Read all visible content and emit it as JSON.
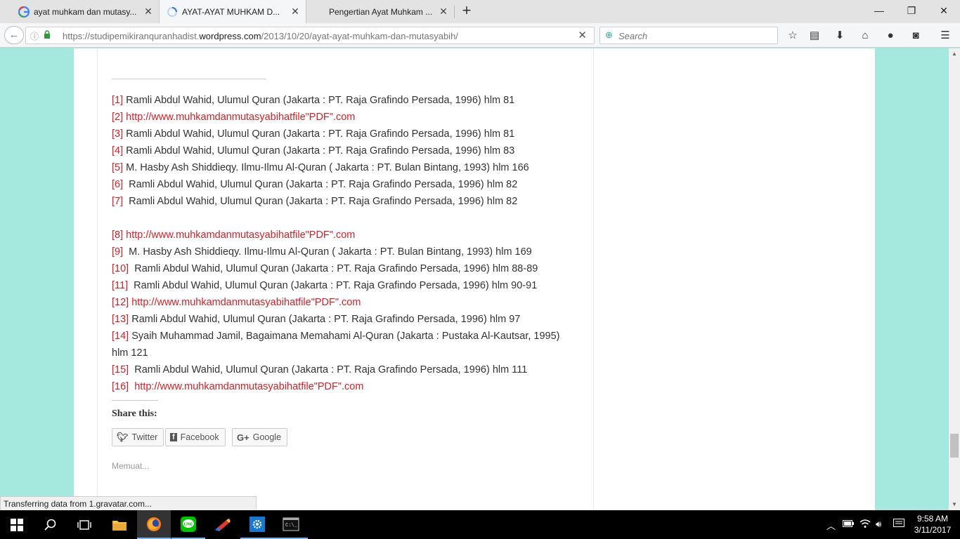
{
  "browser": {
    "tabs": [
      {
        "title": "ayat muhkam dan mutasy...",
        "icon": "google-icon",
        "active": false
      },
      {
        "title": "AYAT-AYAT MUHKAM D...",
        "icon": "loading-icon",
        "active": true
      },
      {
        "title": "Pengertian Ayat Muhkam ...",
        "icon": "blank-page-icon",
        "active": false
      }
    ],
    "url_prefix": "https://studipemikiranquranhadist.",
    "url_domain": "wordpress.com",
    "url_path": "/2013/10/20/ayat-ayat-muhkam-dan-mutasyabih/",
    "search_placeholder": "Search"
  },
  "footnotes": [
    {
      "ref": "[1]",
      "text": " Ramli Abdul Wahid, Ulumul Quran (Jakarta : PT. Raja Grafindo Persada, 1996) hlm 81",
      "is_link": false
    },
    {
      "ref": "[2]",
      "text": " http://www.muhkamdanmutasyabihatfile\"PDF\".com",
      "is_link": true
    },
    {
      "ref": "[3]",
      "text": " Ramli Abdul Wahid, Ulumul Quran (Jakarta : PT. Raja Grafindo Persada, 1996) hlm 81",
      "is_link": false
    },
    {
      "ref": "[4]",
      "text": " Ramli Abdul Wahid, Ulumul Quran (Jakarta : PT. Raja Grafindo Persada, 1996) hlm 83",
      "is_link": false
    },
    {
      "ref": "[5]",
      "text": " M. Hasby Ash Shiddieqy. Ilmu-Ilmu Al-Quran ( Jakarta : PT. Bulan Bintang, 1993) hlm 166",
      "is_link": false
    },
    {
      "ref": "[6]",
      "text": "  Ramli Abdul Wahid, Ulumul Quran (Jakarta : PT. Raja Grafindo Persada, 1996) hlm 82",
      "is_link": false
    },
    {
      "ref": "[7]",
      "text": "  Ramli Abdul Wahid, Ulumul Quran (Jakarta : PT. Raja Grafindo Persada, 1996) hlm 82",
      "is_link": false
    },
    {
      "ref": "[8]",
      "text": " http://www.muhkamdanmutasyabihatfile\"PDF\".com",
      "is_link": true
    },
    {
      "ref": "[9]",
      "text": "  M. Hasby Ash Shiddieqy. Ilmu-Ilmu Al-Quran ( Jakarta : PT. Bulan Bintang, 1993) hlm 169",
      "is_link": false
    },
    {
      "ref": "[10]",
      "text": "  Ramli Abdul Wahid, Ulumul Quran (Jakarta : PT. Raja Grafindo Persada, 1996) hlm 88-89",
      "is_link": false
    },
    {
      "ref": "[11]",
      "text": "  Ramli Abdul Wahid, Ulumul Quran (Jakarta : PT. Raja Grafindo Persada, 1996) hlm 90-91",
      "is_link": false
    },
    {
      "ref": "[12]",
      "text": " http://www.muhkamdanmutasyabihatfile\"PDF\".com",
      "is_link": true
    },
    {
      "ref": "[13]",
      "text": " Ramli Abdul Wahid, Ulumul Quran (Jakarta : PT. Raja Grafindo Persada, 1996) hlm 97",
      "is_link": false
    },
    {
      "ref": "[14]",
      "text": " Syaih Muhammad Jamil, Bagaimana Memahami Al-Quran (Jakarta : Pustaka Al-Kautsar, 1995) hlm 121",
      "is_link": false
    },
    {
      "ref": "[15]",
      "text": "  Ramli Abdul Wahid, Ulumul Quran (Jakarta : PT. Raja Grafindo Persada, 1996) hlm 111",
      "is_link": false
    },
    {
      "ref": "[16]",
      "text": "  http://www.muhkamdanmutasyabihatfile\"PDF\".com",
      "is_link": true
    }
  ],
  "share": {
    "title": "Share this:",
    "twitter": "Twitter",
    "facebook": "Facebook",
    "google": "Google"
  },
  "loading": "Memuat...",
  "status": "Transferring data from 1.gravatar.com...",
  "taskbar": {
    "time": "9:58 AM",
    "date": "3/11/2017"
  },
  "colors": {
    "page_bg": "#a4e8de",
    "link_red": "#d81f26",
    "text": "#333333"
  }
}
